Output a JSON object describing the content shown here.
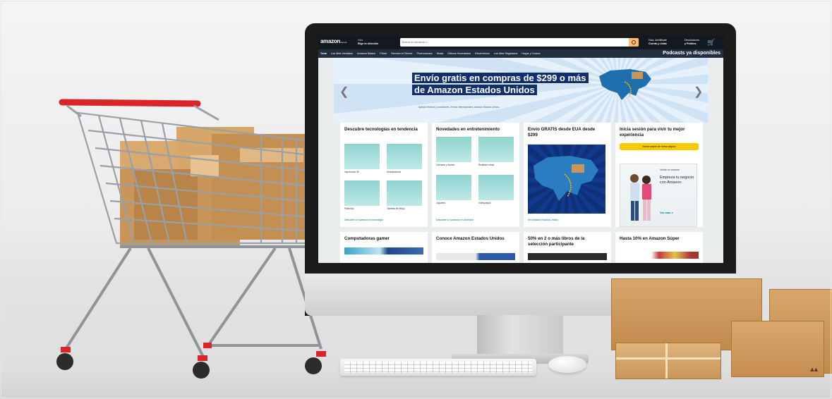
{
  "header": {
    "logo": "amazon",
    "logo_sub": ".com.mx",
    "deliver_line1": "Hola",
    "deliver_line2": "Elige tu dirección",
    "search_placeholder": "Busca en Amazon.c",
    "account_line1": "Hola, identifícate",
    "account_line2": "Cuenta y Listas",
    "orders_line1": "Devoluciones",
    "orders_line2": "y Pedidos",
    "cart_icon": "cart-icon"
  },
  "nav": {
    "items": [
      "Todo",
      "Los Más Vendidos",
      "Amazon Basics",
      "Prime",
      "Servicio al Cliente",
      "Promociones",
      "Moda",
      "Últimos Novedades",
      "Electrónicos",
      "Los Más Regalados",
      "Hogar y Cocina"
    ],
    "right": "Podcasts ya disponibles"
  },
  "hero": {
    "line1": "Envío gratis en compras de $299 o más",
    "line2": "de Amazon Estados Unidos",
    "fine": "Aplican términos y condiciones. Envíos internacionales. Amazon Estados Unidos."
  },
  "cards": [
    {
      "title": "Descubre tecnologías en tendencia",
      "tiles": [
        "Impresoras 3D",
        "Smartwatches",
        "Patinetas",
        "Tabletas de dibujo"
      ],
      "link": "Descubre lo novedoso en tecnología"
    },
    {
      "title": "Novedades en entretenimiento",
      "tiles": [
        "Cámaras y drones",
        "Realidad virtual",
        "Juguetes",
        "Videojuegos"
      ],
      "link": "Descubre lo novedoso en diversión"
    },
    {
      "title": "Envío GRATIS desde EUA desde $299",
      "link": "Ver Amazon Estados Unidos"
    },
    {
      "title": "Inicia sesión para vivir tu mejor experiencia",
      "button": "Iniciar sesión de forma segura",
      "ad_top": "Vende en amazon",
      "ad_text": "Empieza tu negocio con Amazon.",
      "ad_link": "Ver más >"
    }
  ],
  "row2": [
    "Computadoras gamer",
    "Conoce Amazon Estados Unidos",
    "50% en 2 o más libros de la selección participante",
    "Hasta 10% en Amazon Súper"
  ],
  "colors": {
    "header": "#131921",
    "nav": "#232f3e",
    "search_button": "#febd69",
    "hero_banner": "#11306b",
    "cta": "#f7ca00",
    "cart_handle": "#d9252a",
    "cardboard": "#c9965a"
  }
}
